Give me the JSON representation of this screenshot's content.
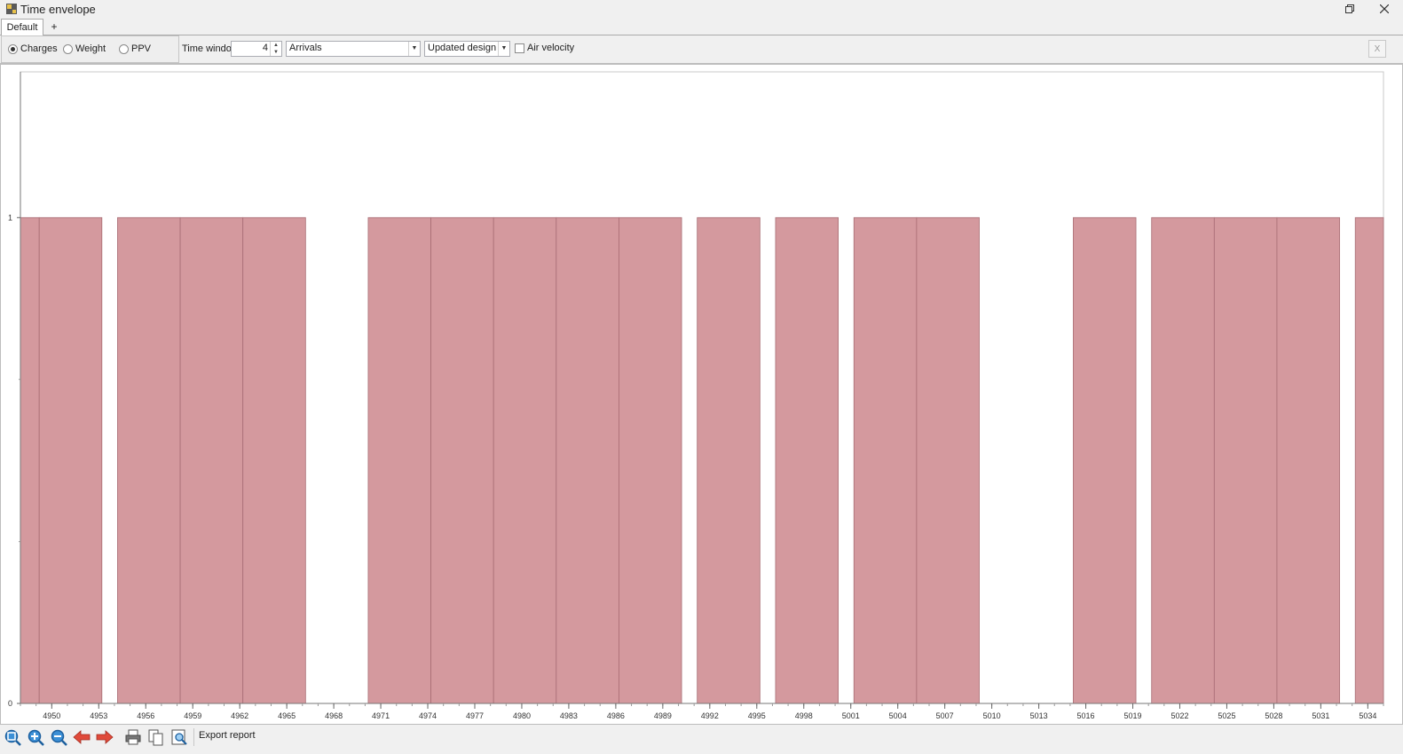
{
  "window": {
    "title": "Time envelope"
  },
  "tabs": [
    {
      "label": "Default"
    },
    {
      "label": "+"
    }
  ],
  "toolbar": {
    "radios": [
      {
        "label": "Charges",
        "checked": true
      },
      {
        "label": "Weight",
        "checked": false
      },
      {
        "label": "PPV",
        "checked": false
      }
    ],
    "time_window_label": "Time window",
    "time_window_value": "4",
    "mode_value": "Arrivals",
    "design_value": "Updated design",
    "air_velocity_label": "Air velocity",
    "close_label": "X"
  },
  "bottom": {
    "export_label": "Export report"
  },
  "colors": {
    "bar_fill": "#d4999e",
    "bar_stroke": "#a86d74"
  },
  "chart_data": {
    "type": "bar",
    "xlabel": "",
    "ylabel": "",
    "xlim": [
      4948,
      5035
    ],
    "ylim": [
      0,
      1.3
    ],
    "y_ticks": [
      {
        "value": 0,
        "label": "0"
      },
      {
        "value": 1,
        "label": "1"
      }
    ],
    "y_minor_ticks": [
      0.333,
      0.667
    ],
    "x_tick_labels": [
      "4950",
      "4953",
      "4956",
      "4959",
      "4962",
      "4965",
      "4968",
      "4971",
      "4974",
      "4977",
      "4980",
      "4983",
      "4986",
      "4989",
      "4992",
      "4995",
      "4998",
      "5001",
      "5004",
      "5007",
      "5010",
      "5013",
      "5016",
      "5019",
      "5022",
      "5025",
      "5028",
      "5031",
      "5034"
    ],
    "bars": [
      {
        "x0": 4948,
        "x1": 4949.2,
        "value": 1
      },
      {
        "x0": 4949.2,
        "x1": 4953.2,
        "value": 1
      },
      {
        "x0": 4954.2,
        "x1": 4958.2,
        "value": 1
      },
      {
        "x0": 4958.2,
        "x1": 4962.2,
        "value": 1
      },
      {
        "x0": 4962.2,
        "x1": 4966.2,
        "value": 1
      },
      {
        "x0": 4970.2,
        "x1": 4974.2,
        "value": 1
      },
      {
        "x0": 4974.2,
        "x1": 4978.2,
        "value": 1
      },
      {
        "x0": 4978.2,
        "x1": 4982.2,
        "value": 1
      },
      {
        "x0": 4982.2,
        "x1": 4986.2,
        "value": 1
      },
      {
        "x0": 4986.2,
        "x1": 4990.2,
        "value": 1
      },
      {
        "x0": 4991.2,
        "x1": 4995.2,
        "value": 1
      },
      {
        "x0": 4996.2,
        "x1": 5000.2,
        "value": 1
      },
      {
        "x0": 5001.2,
        "x1": 5005.2,
        "value": 1
      },
      {
        "x0": 5005.2,
        "x1": 5009.2,
        "value": 1
      },
      {
        "x0": 5015.2,
        "x1": 5019.2,
        "value": 1
      },
      {
        "x0": 5020.2,
        "x1": 5024.2,
        "value": 1
      },
      {
        "x0": 5024.2,
        "x1": 5028.2,
        "value": 1
      },
      {
        "x0": 5028.2,
        "x1": 5032.2,
        "value": 1
      },
      {
        "x0": 5033.2,
        "x1": 5035,
        "value": 1
      }
    ]
  }
}
